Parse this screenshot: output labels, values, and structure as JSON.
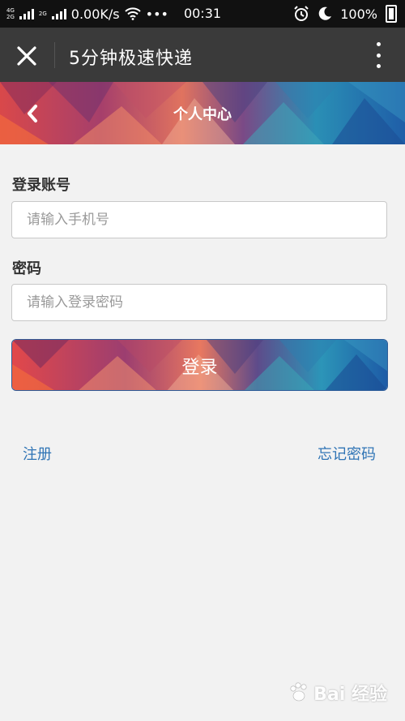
{
  "status_bar": {
    "network_top": "4G",
    "network_bottom": "2G",
    "network_2g": "2G",
    "speed": "0.00K/s",
    "more": "•••",
    "time": "00:31",
    "battery": "100%"
  },
  "webview": {
    "title": "5分钟极速快递"
  },
  "header": {
    "title": "个人中心"
  },
  "form": {
    "account_label": "登录账号",
    "account_placeholder": "请输入手机号",
    "password_label": "密码",
    "password_placeholder": "请输入登录密码",
    "login_label": "登录"
  },
  "links": {
    "register": "注册",
    "forgot": "忘记密码"
  },
  "watermark": {
    "text": "Bai 经验"
  },
  "colors": {
    "link": "#2f74b5",
    "titlebar": "#3a3a3a",
    "page_bg": "#f2f2f2"
  }
}
